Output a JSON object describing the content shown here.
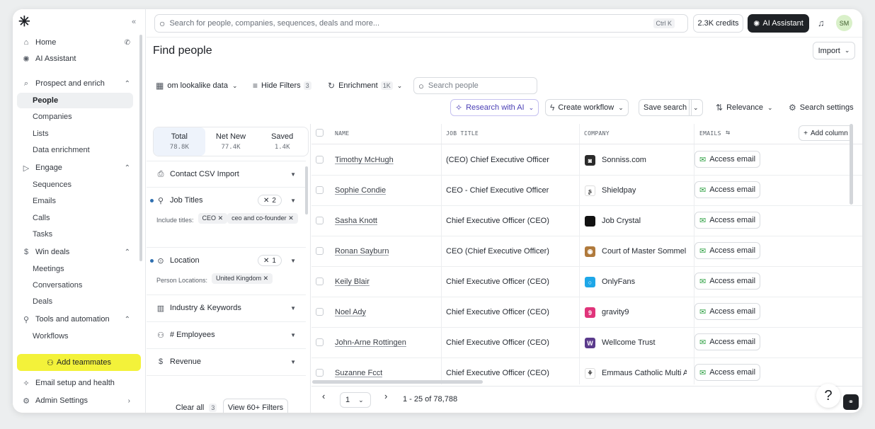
{
  "sidebar": {
    "collapse_icon": "«",
    "nav": [
      {
        "label": "Home",
        "icon": "home-icon",
        "glyph": "⌂"
      },
      {
        "label": "AI Assistant",
        "icon": "ai-icon",
        "glyph": "✺"
      }
    ],
    "groups": [
      {
        "label": "Prospect and enrich",
        "glyph": "⌕",
        "items": [
          "People",
          "Companies",
          "Lists",
          "Data enrichment"
        ]
      },
      {
        "label": "Engage",
        "glyph": "▷",
        "items": [
          "Sequences",
          "Emails",
          "Calls",
          "Tasks"
        ]
      },
      {
        "label": "Win deals",
        "glyph": "$",
        "items": [
          "Meetings",
          "Conversations",
          "Deals"
        ]
      },
      {
        "label": "Tools and automation",
        "glyph": "⚲",
        "items": [
          "Workflows"
        ]
      }
    ],
    "add_teammates": "Add teammates",
    "email_setup": "Email setup and health",
    "admin_settings": "Admin Settings"
  },
  "topbar": {
    "search_placeholder": "Search for people, companies, sequences, deals and more...",
    "shortcut": "Ctrl  K",
    "credits": "2.3K credits",
    "ai_assistant": "AI Assistant",
    "avatar_initials": "SM"
  },
  "page": {
    "title": "Find people",
    "import_label": "Import"
  },
  "toolbar": {
    "lookalike": "om lookalike data",
    "hide_filters": "Hide Filters",
    "hide_filters_count": "3",
    "enrichment": "Enrichment",
    "enrichment_count": "1K",
    "search_people_placeholder": "Search people",
    "research_ai": "Research with AI",
    "create_workflow": "Create workflow",
    "save_search": "Save search",
    "relevance": "Relevance",
    "search_settings": "Search settings"
  },
  "segments": [
    {
      "label": "Total",
      "value": "78.8K"
    },
    {
      "label": "Net New",
      "value": "77.4K"
    },
    {
      "label": "Saved",
      "value": "1.4K"
    }
  ],
  "filters": {
    "contact_csv": "Contact CSV Import",
    "job_titles": "Job Titles",
    "job_titles_count": "2",
    "include_titles_label": "Include titles:",
    "titles": [
      "CEO",
      "ceo and co-founder"
    ],
    "location": "Location",
    "location_count": "1",
    "person_locations_label": "Person Locations:",
    "locations": [
      "United Kingdom"
    ],
    "industry": "Industry & Keywords",
    "employees": "# Employees",
    "revenue": "Revenue",
    "clear_all": "Clear all",
    "clear_count": "3",
    "view_filters": "View 60+ Filters"
  },
  "table": {
    "columns": {
      "name": "NAME",
      "job_title": "JOB TITLE",
      "company": "COMPANY",
      "emails": "EMAILS"
    },
    "add_column": "Add column",
    "access_email": "Access email",
    "rows": [
      {
        "name": "Timothy McHugh",
        "title": "(CEO) Chief Executive Officer",
        "company": "Sonniss.com",
        "logo_color": "#2b2b2b",
        "logo_text": "◙"
      },
      {
        "name": "Sophie Condie",
        "title": "CEO - Chief Executive Officer",
        "company": "Shieldpay",
        "logo_color": "#ffffff",
        "logo_text": "ʂ"
      },
      {
        "name": "Sasha Knott",
        "title": "Chief Executive Officer (CEO)",
        "company": "Job Crystal",
        "logo_color": "#111111",
        "logo_text": ""
      },
      {
        "name": "Ronan Sayburn",
        "title": "CEO (Chief Executive Officer)",
        "company": "Court of Master Sommeli",
        "logo_color": "#b07a3c",
        "logo_text": "◉"
      },
      {
        "name": "Keily Blair",
        "title": "Chief Executive Officer (CEO)",
        "company": "OnlyFans",
        "logo_color": "#1ea7e8",
        "logo_text": "○"
      },
      {
        "name": "Noel Ady",
        "title": "Chief Executive Officer (CEO)",
        "company": "gravity9",
        "logo_color": "#e0347a",
        "logo_text": "9"
      },
      {
        "name": "John-Arne Rottingen",
        "title": "Chief Executive Officer (CEO)",
        "company": "Wellcome Trust",
        "logo_color": "#5b3b8c",
        "logo_text": "W"
      },
      {
        "name": "Suzanne Fcct",
        "title": "Chief Executive Officer (CEO)",
        "company": "Emmaus Catholic Multi A",
        "logo_color": "#ffffff",
        "logo_text": "⚘"
      }
    ]
  },
  "pagination": {
    "page": "1",
    "range": "1 - 25 of 78,788"
  }
}
